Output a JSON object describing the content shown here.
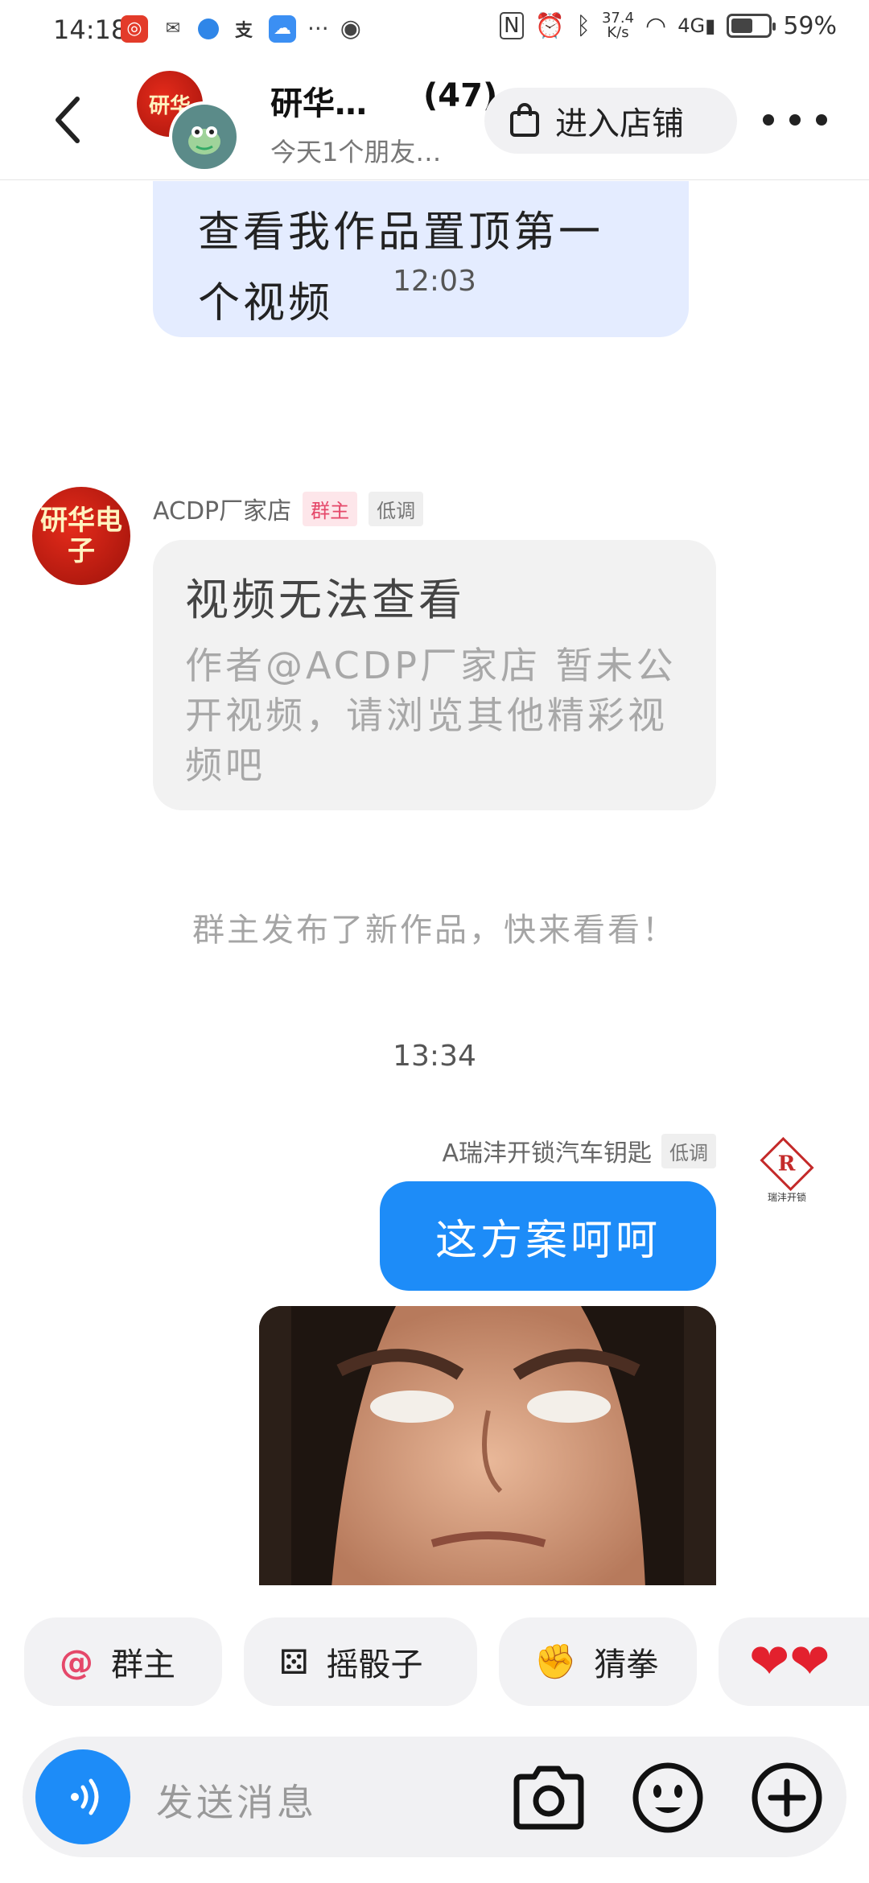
{
  "status_bar": {
    "time": "14:18",
    "net_speed_value": "37.4",
    "net_speed_unit": "K/s",
    "battery": "59%",
    "battery_level": 0.59
  },
  "header": {
    "group_name": "研华…",
    "member_count": "(47)",
    "subtitle": "今天1个朋友…",
    "store_button": "进入店铺"
  },
  "chat": {
    "top_bubble_text": "查看我作品置顶第一个视频",
    "time_1": "12:03",
    "message_1": {
      "avatar_text": "研华电子",
      "sender": "ACDP厂家店",
      "tag_owner": "群主",
      "tag_status": "低调",
      "card_title": "视频无法查看",
      "card_body": "作者@ACDP厂家店 暂未公开视频，请浏览其他精彩视频吧"
    },
    "system_note": "群主发布了新作品，快来看看！",
    "time_2": "13:34",
    "message_2": {
      "sender": "A瑞沣开锁汽车钥匙",
      "tag_status": "低调",
      "avatar_logo": "R",
      "avatar_caption": "瑞沣开锁",
      "text": "这方案呵呵"
    }
  },
  "quick_actions": [
    {
      "icon": "at-icon",
      "label": "群主"
    },
    {
      "icon": "dice-icon",
      "label": "摇骰子"
    },
    {
      "icon": "rock-paper-scissors-icon",
      "label": "猜拳"
    },
    {
      "icon": "hearts-icon",
      "label": ""
    }
  ],
  "input": {
    "placeholder": "发送消息"
  },
  "colors": {
    "accent_blue": "#1d8cf8",
    "bubble_light_blue": "#e4ecff",
    "owner_tag": "#e5486a"
  }
}
